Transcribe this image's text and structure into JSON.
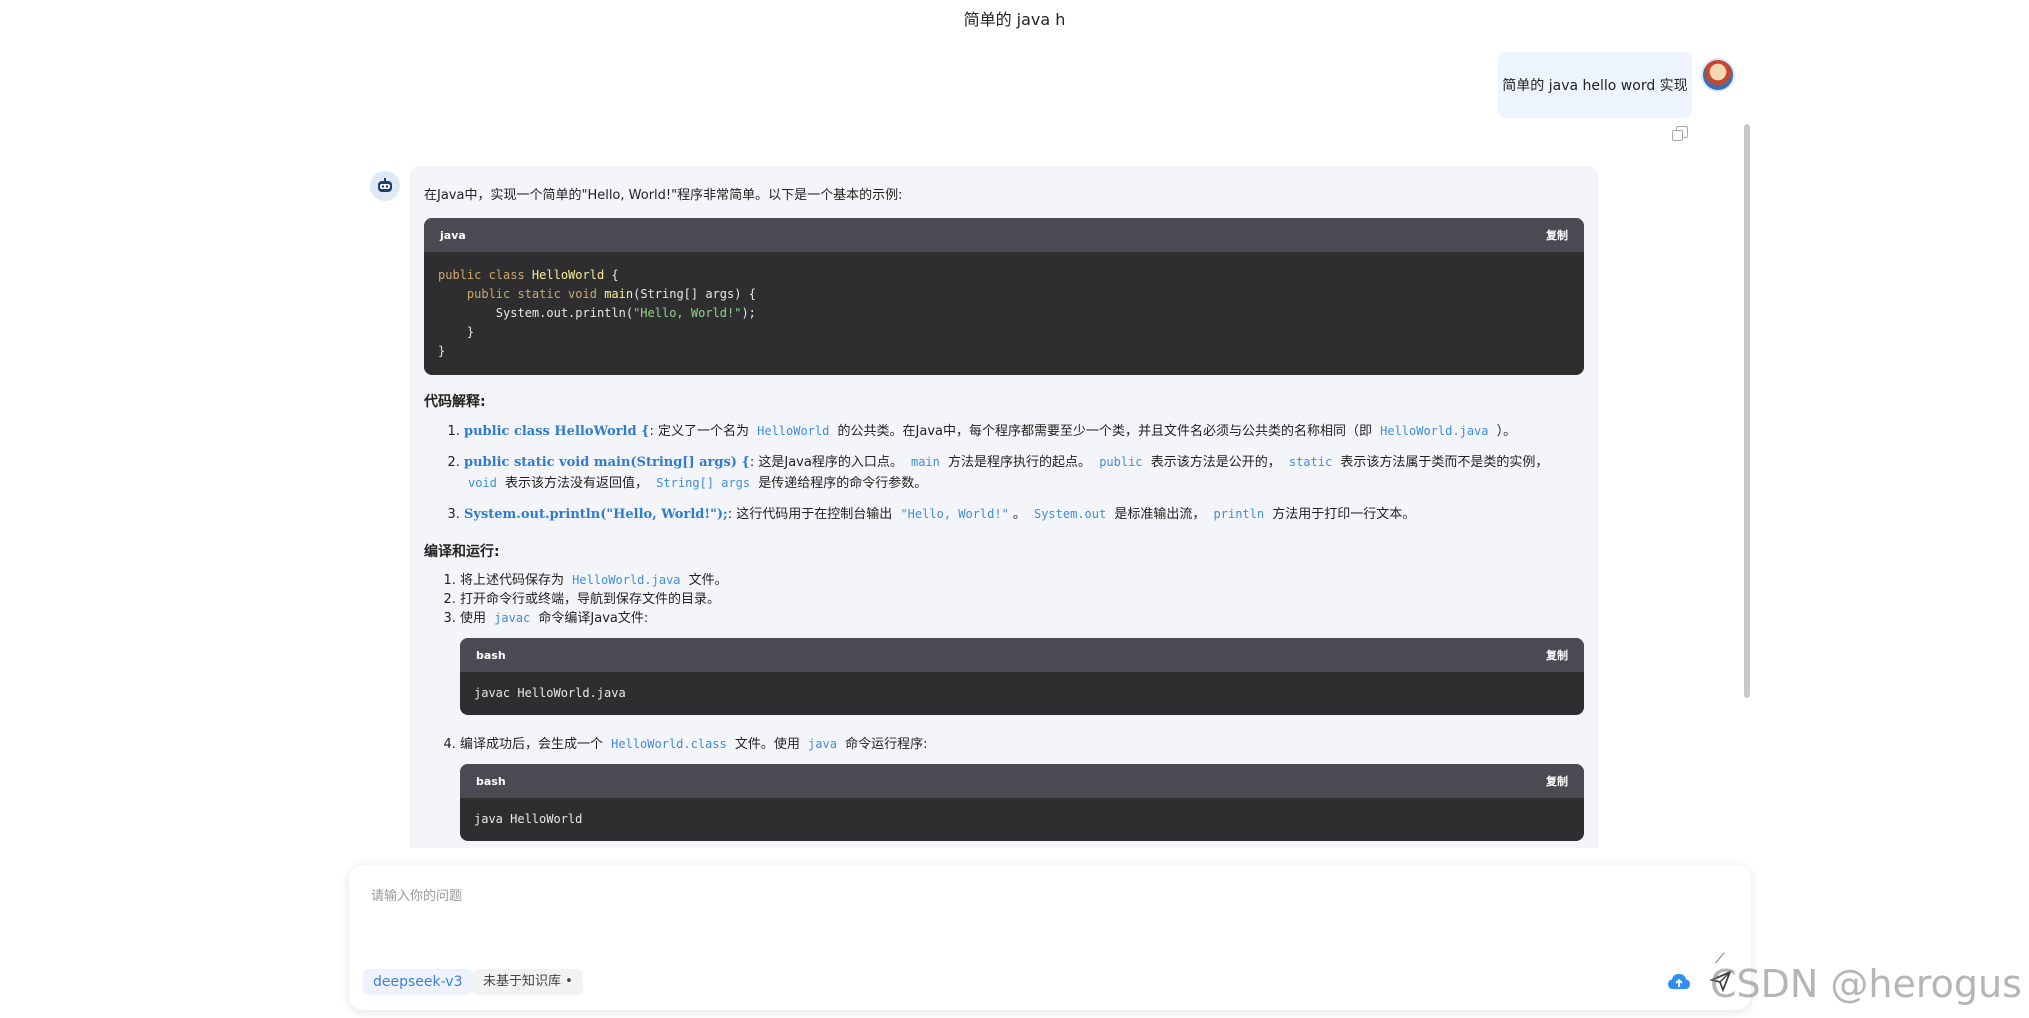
{
  "conversation_title": "简单的 java h",
  "user_message": "简单的 java hello word 实现",
  "assistant": {
    "intro": "在Java中，实现一个简单的\"Hello, World!\"程序非常简单。以下是一个基本的示例:",
    "main_code": {
      "language": "java",
      "copy_label": "复制",
      "lines": [
        "public class HelloWorld {",
        "    public static void main(String[] args) {",
        "        System.out.println(\"Hello, World!\");",
        "    }",
        "}"
      ]
    },
    "explain_title": "代码解释:",
    "explain_items": [
      {
        "code": "public class HelloWorld {",
        "text_before": ": 定义了一个名为",
        "inline1": "HelloWorld",
        "text_middle": "的公共类。在Java中，每个程序都需要至少一个类，并且文件名必须与公共类的名称相同（即",
        "inline2": "HelloWorld.java",
        "text_after": "）。"
      },
      {
        "code": "public static void main(String[] args) {",
        "text_before": ": 这是Java程序的入口点。",
        "inline1": "main",
        "text_1": "方法是程序执行的起点。",
        "inline2": "public",
        "text_2": "表示该方法是公开的，",
        "inline3": "static",
        "text_3": "表示该方法属于类而不是类的实例，",
        "inline4": "void",
        "text_4": "表示该方法没有返回值，",
        "inline5": "String[] args",
        "text_5": "是传递给程序的命令行参数。"
      },
      {
        "code": "System.out.println(\"Hello, World!\");",
        "text_before": ": 这行代码用于在控制台输出",
        "inline1": "\"Hello, World!\"",
        "text_1": "。",
        "inline2": "System.out",
        "text_2": "是标准输出流，",
        "inline3": "println",
        "text_3": "方法用于打印一行文本。"
      }
    ],
    "run_title": "编译和运行:",
    "steps": {
      "s1_before": "将上述代码保存为",
      "s1_code": "HelloWorld.java",
      "s1_after": "文件。",
      "s2": "打开命令行或终端，导航到保存文件的目录。",
      "s3_before": "使用",
      "s3_code": "javac",
      "s3_after": "命令编译Java文件:",
      "s3_block": {
        "language": "bash",
        "copy_label": "复制",
        "code": "javac HelloWorld.java"
      },
      "s4_before": "编译成功后，会生成一个",
      "s4_code": "HelloWorld.class",
      "s4_mid": "文件。使用",
      "s4_code2": "java",
      "s4_after": "命令运行程序:",
      "s4_block": {
        "language": "bash",
        "copy_label": "复制",
        "code": "java HelloWorld"
      }
    }
  },
  "input": {
    "placeholder": "请输入你的问题",
    "model_label": "deepseek-v3",
    "kb_label": "未基于知识库 •"
  },
  "watermark": "CSDN @herogus丶",
  "colors": {
    "accent": "#3d8de0",
    "code_bg": "#2e2e30",
    "code_head": "#4a4a52"
  },
  "icons": [
    "copy-icon",
    "edit-icon",
    "upload-icon",
    "send-icon",
    "bot-avatar",
    "user-avatar"
  ]
}
